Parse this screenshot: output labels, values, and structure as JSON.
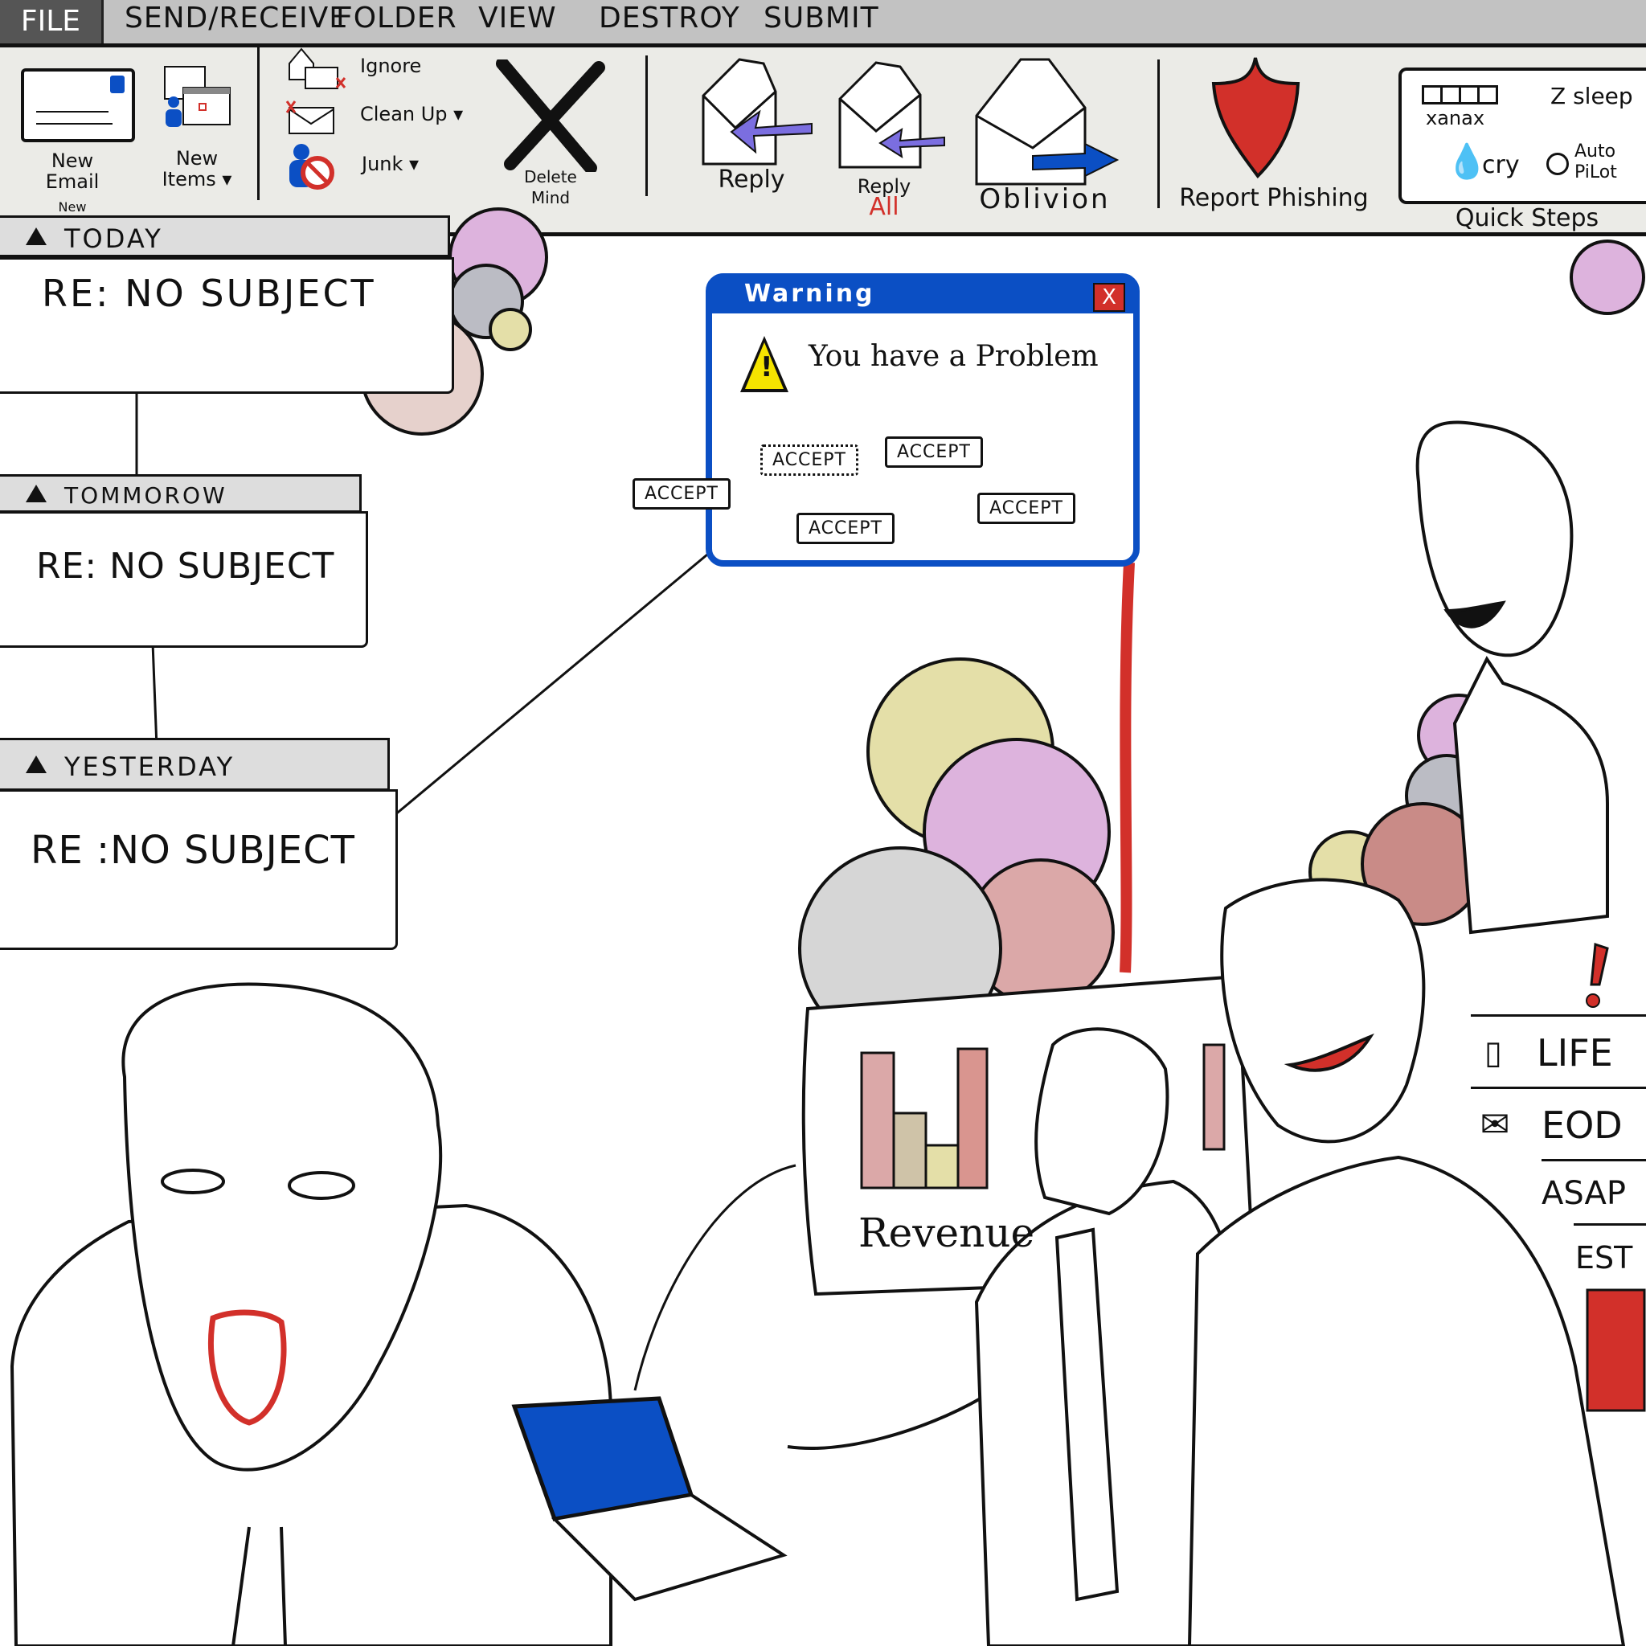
{
  "menu": {
    "file": "FILE",
    "items": [
      "SEND/RECEIVE",
      "FOLDER",
      "VIEW",
      "DESTROY",
      "SUBMIT"
    ]
  },
  "ribbon": {
    "new_email": "New Email",
    "new_items": "New Items ▾",
    "new_group": "New",
    "ignore": "Ignore",
    "clean_up": "Clean Up ▾",
    "junk": "Junk ▾",
    "delete_mind": "Delete Mind",
    "reply": "Reply",
    "reply_all_top": "Reply",
    "reply_all_bottom": "All",
    "oblivion": "Oblivion",
    "report_phishing": "Report Phishing",
    "quick_steps": {
      "label": "Quick Steps",
      "items": [
        "xanax",
        "Z sleep",
        "cry",
        "Auto PiLot"
      ]
    }
  },
  "folders": [
    {
      "header": "TODAY",
      "subject": "RE: NO SUBJECT"
    },
    {
      "header": "TOMMOROW",
      "subject": "RE: NO SUBJECT"
    },
    {
      "header": "YESTERDAY",
      "subject": "RE :NO SUBJECT"
    }
  ],
  "warning": {
    "title": "Warning",
    "close": "X",
    "message": "You have a Problem",
    "buttons": [
      "ACCEPT",
      "ACCEPT",
      "ACCEPT",
      "ACCEPT",
      "ACCEPT"
    ]
  },
  "revenue_label": "Revenue",
  "categories": [
    "LIFE",
    "EOD",
    "ASAP",
    "EST"
  ],
  "colors": {
    "menubar": "#c2c2c2",
    "ribbon": "#ebebe7",
    "file_button": "#555555",
    "accent_blue": "#0b4fc4",
    "alert_red": "#d2302a",
    "arrow_purple": "#7b6ee0"
  }
}
